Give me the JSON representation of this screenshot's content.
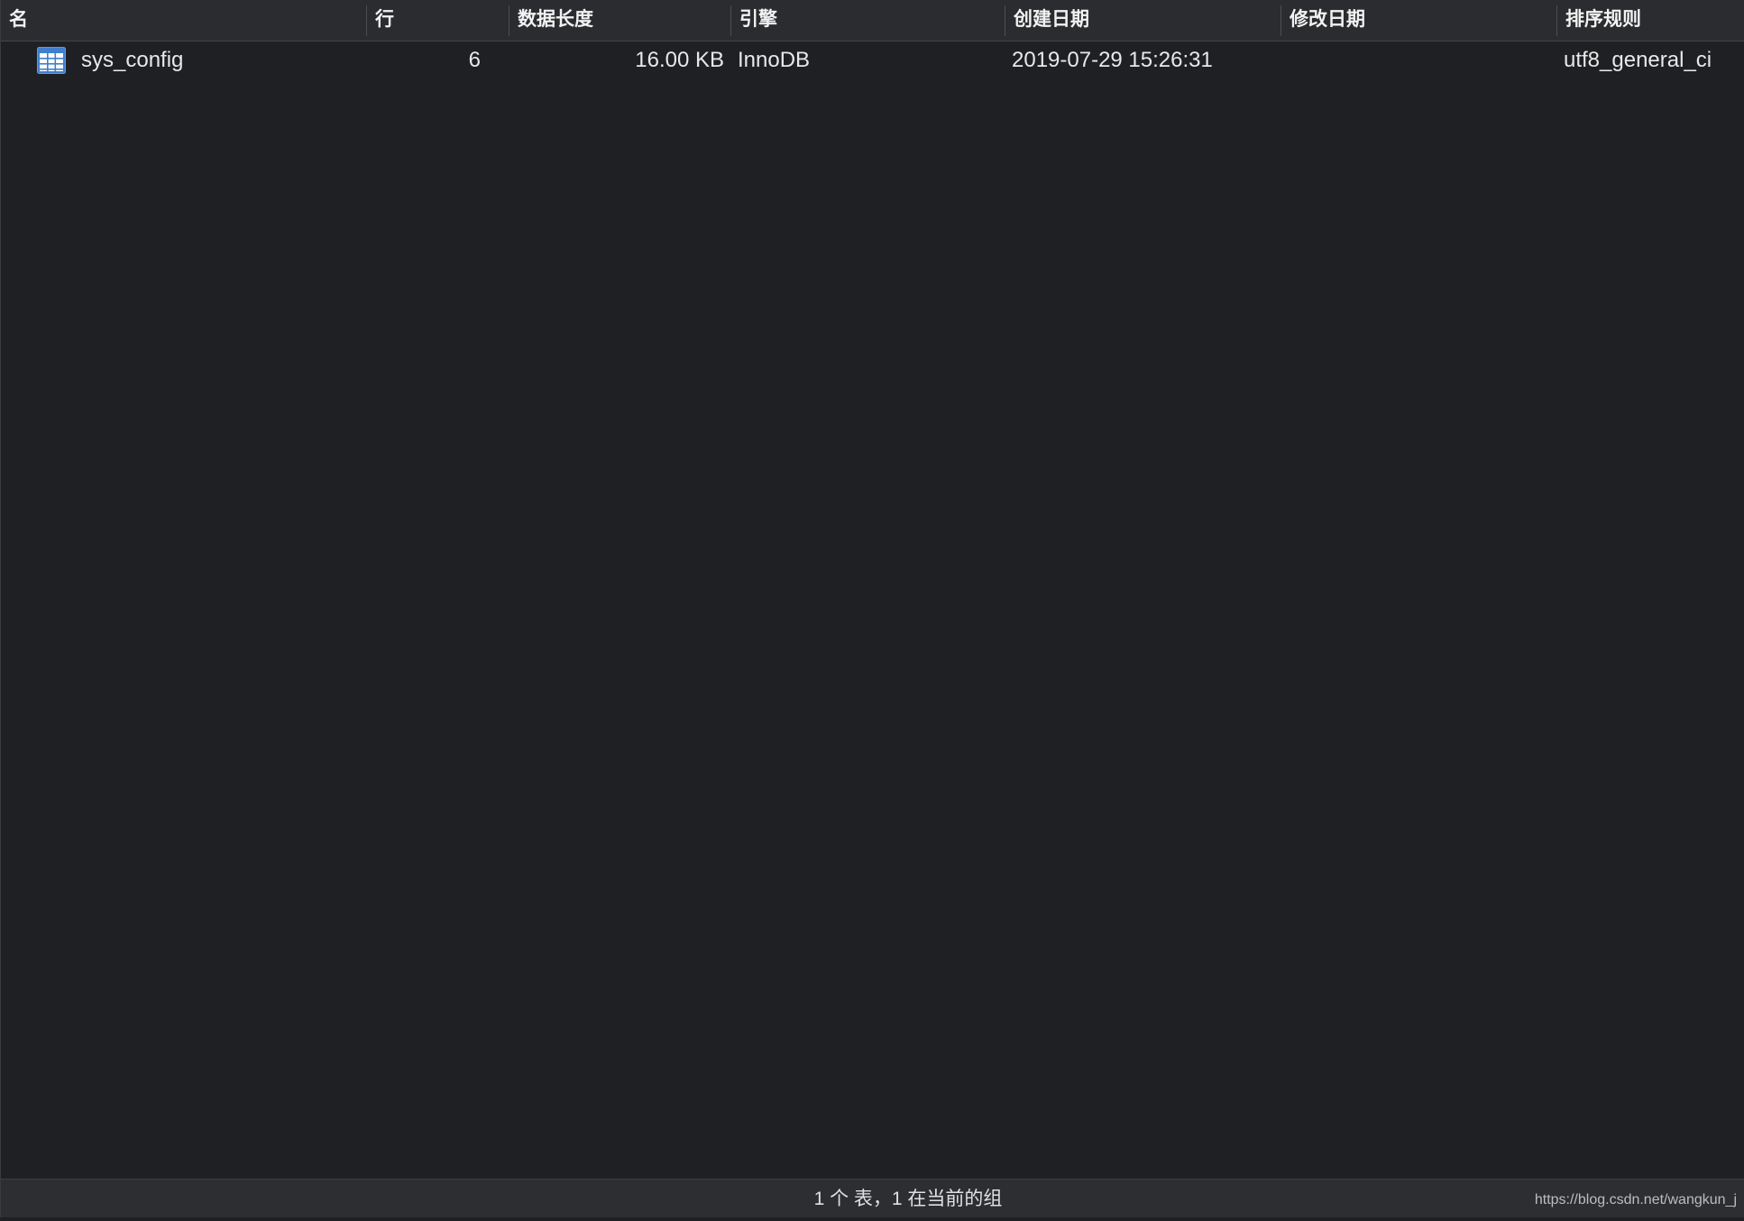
{
  "columns": [
    {
      "label": "名"
    },
    {
      "label": "行"
    },
    {
      "label": "数据长度"
    },
    {
      "label": "引擎"
    },
    {
      "label": "创建日期"
    },
    {
      "label": "修改日期"
    },
    {
      "label": "排序规则"
    }
  ],
  "rows": [
    {
      "icon": "table-icon",
      "name": "sys_config",
      "rows": "6",
      "data_length": "16.00 KB",
      "engine": "InnoDB",
      "created": "2019-07-29 15:26:31",
      "modified": "",
      "collation": "utf8_general_ci"
    }
  ],
  "status": {
    "summary": "1 个 表，1 在当前的组",
    "watermark": "https://blog.csdn.net/wangkun_j"
  },
  "colors": {
    "background": "#1f2023",
    "header_background": "#2b2c2f",
    "icon_blue": "#4a90d9"
  }
}
